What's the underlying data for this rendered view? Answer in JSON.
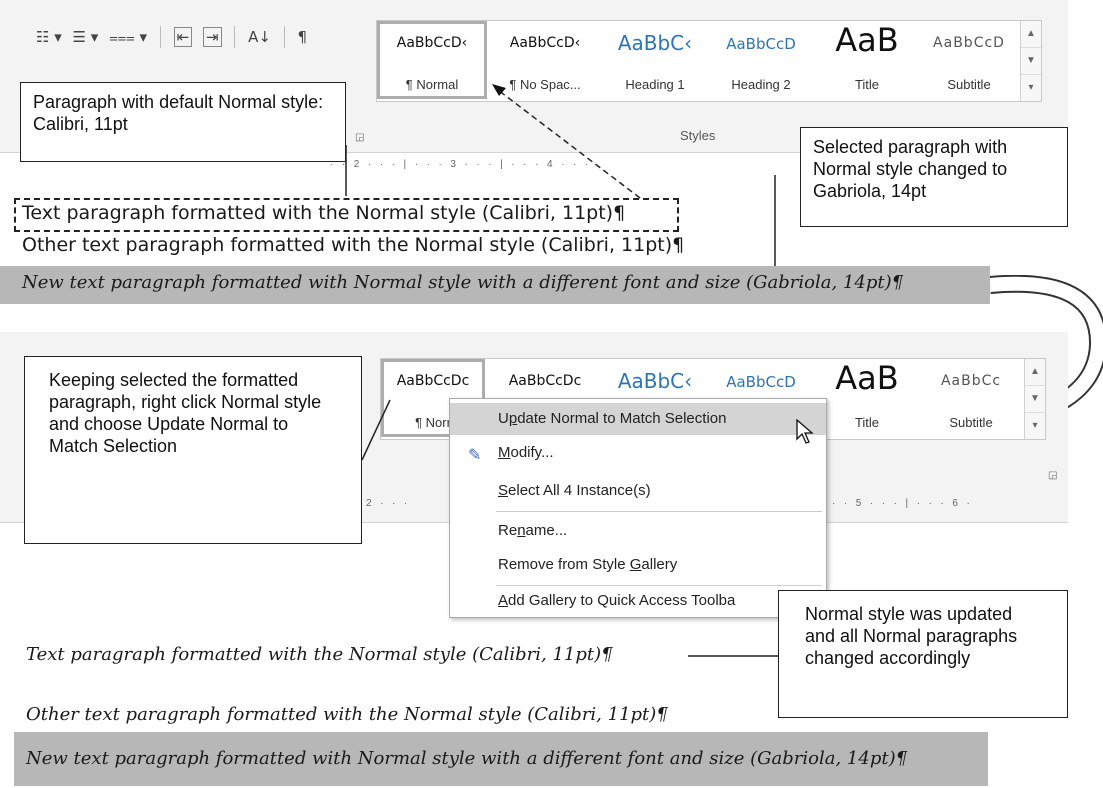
{
  "top_ribbon": {
    "para_tools": [
      "☷ ▾",
      "☰ ▾",
      "⩶ ▾",
      "⇤",
      "⇥",
      "A↓",
      "¶"
    ],
    "styles": [
      {
        "sample": "AaBbCcD‹",
        "name": "¶ Normal"
      },
      {
        "sample": "AaBbCcD‹",
        "name": "¶ No Spac..."
      },
      {
        "sample": "AaBbC‹",
        "name": "Heading 1"
      },
      {
        "sample": "AaBbCcD",
        "name": "Heading 2"
      },
      {
        "sample": "AaB",
        "name": "Title"
      },
      {
        "sample": "AaBbCcD",
        "name": "Subtitle"
      }
    ],
    "group_label": "Styles",
    "ruler": "·  ·  2  ·  ·  ·  |  ·  ·  ·  3  ·  ·  ·  |  ·  ·  ·  4  ·  ·  ·"
  },
  "callouts": {
    "default_style": "Paragraph with default Normal style: Calibri, 11pt",
    "selected_para": "Selected paragraph with Normal style changed to Gabriola, 14pt",
    "keeping_selected": "Keeping selected the formatted paragraph, right click Normal style and choose Update Normal to Match Selection",
    "updated": "Normal style was updated and all Normal paragraphs changed accordingly"
  },
  "doc_before": {
    "p1": "Text paragraph formatted with the Normal style (Calibri, 11pt)¶",
    "p2": "Other text paragraph formatted with the Normal style (Calibri, 11pt)¶",
    "p3": "New text paragraph formatted with Normal style with a different font and size (Gabriola, 14pt)¶"
  },
  "bottom_ribbon": {
    "styles": [
      {
        "sample": "AaBbCcDc",
        "name": "¶ Norr"
      },
      {
        "sample": "AaBbCcDc",
        "name": ""
      },
      {
        "sample": "AaBbC‹",
        "name": ""
      },
      {
        "sample": "AaBbCcD",
        "name": ""
      },
      {
        "sample": "AaB",
        "name": "Title"
      },
      {
        "sample": "AaBbCc",
        "name": "Subtitle"
      }
    ],
    "ruler_left": "2  ·  ·  ·",
    "ruler_right": "·  ·  5  ·  ·  ·  |  ·  ·  ·  6  ·"
  },
  "context_menu": {
    "items": [
      {
        "label": "Update Normal to Match Selection",
        "accel": "p",
        "highlighted": true
      },
      {
        "label": "Modify...",
        "accel": "M"
      },
      {
        "label": "Select All 4 Instance(s)",
        "accel": "S"
      },
      {
        "label": "Rename...",
        "accel": "n"
      },
      {
        "label": "Remove from Style Gallery",
        "accel": "G"
      },
      {
        "label": "Add Gallery to Quick Access Toolba",
        "accel": "A"
      }
    ]
  },
  "doc_after": {
    "p1": "Text paragraph formatted with the Normal style (Calibri, 11pt)¶",
    "p2": "Other text paragraph formatted with the Normal style (Calibri, 11pt)¶",
    "p3": "New text paragraph formatted with Normal style with a different font and size (Gabriola, 14pt)¶"
  }
}
